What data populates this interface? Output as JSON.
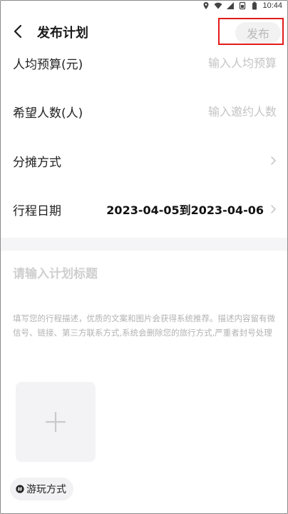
{
  "status_bar": {
    "time": "10:44",
    "icons": [
      "location-icon",
      "wifi-icon",
      "signal-icon",
      "sim-icon",
      "battery-icon"
    ]
  },
  "header": {
    "title": "发布计划",
    "publish_label": "发布",
    "back_icon": "back-arrow-icon"
  },
  "form": {
    "budget": {
      "label": "人均预算(元)",
      "placeholder": "输入人均预算",
      "value": ""
    },
    "people": {
      "label": "希望人数(人)",
      "placeholder": "输入邀约人数",
      "value": ""
    },
    "split": {
      "label": "分摊方式",
      "value": ""
    },
    "dates": {
      "label": "行程日期",
      "value": "2023-04-05到2023-04-06"
    }
  },
  "plan": {
    "title_placeholder": "请输入计划标题",
    "description_placeholder": "填写您的行程描述，优质的文案和图片会获得系统推荐。描述内容留有微信号、链接、第三方联系方式,系统会删除您的旅行方式,严重者封号处理"
  },
  "photo": {
    "add_icon": "plus-icon"
  },
  "tag": {
    "label": "游玩方式",
    "icon": "hash-circle-icon"
  },
  "colors": {
    "accent_highlight": "#e31b1b",
    "placeholder": "#c4c4c4",
    "section_band": "#f5f5f7",
    "chip_bg": "#f2f2f4"
  }
}
